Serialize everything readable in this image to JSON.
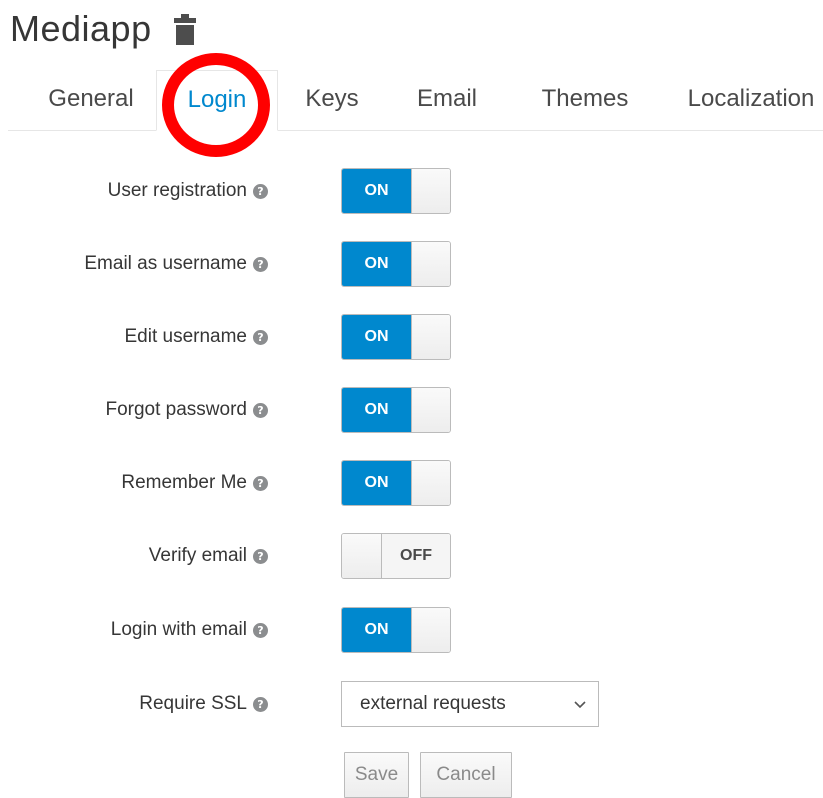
{
  "header": {
    "title": "Mediapp",
    "delete_icon": "trash-icon"
  },
  "tabs": [
    {
      "label": "General",
      "active": false
    },
    {
      "label": "Login",
      "active": true
    },
    {
      "label": "Keys",
      "active": false
    },
    {
      "label": "Email",
      "active": false
    },
    {
      "label": "Themes",
      "active": false
    },
    {
      "label": "Localization",
      "active": false
    }
  ],
  "settings": [
    {
      "label": "User registration",
      "state": "ON"
    },
    {
      "label": "Email as username",
      "state": "ON"
    },
    {
      "label": "Edit username",
      "state": "ON"
    },
    {
      "label": "Forgot password",
      "state": "ON"
    },
    {
      "label": "Remember Me",
      "state": "ON"
    },
    {
      "label": "Verify email",
      "state": "OFF"
    },
    {
      "label": "Login with email",
      "state": "ON"
    }
  ],
  "require_ssl": {
    "label": "Require SSL",
    "value": "external requests"
  },
  "help_icon": "question-circle-icon",
  "buttons": {
    "save": "Save",
    "cancel": "Cancel"
  },
  "colors": {
    "accent": "#0088ce",
    "annotation": "#ff0000"
  }
}
